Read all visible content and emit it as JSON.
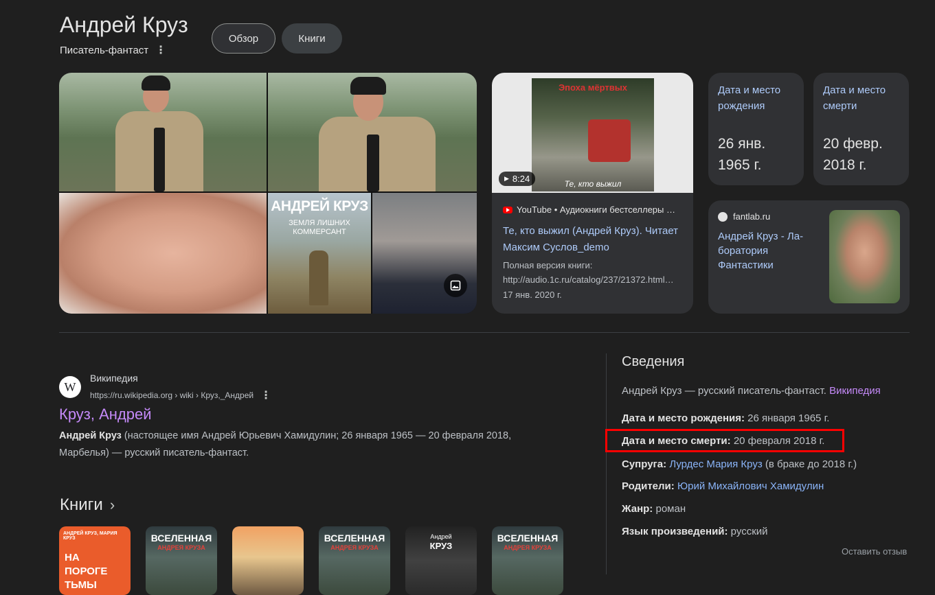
{
  "header": {
    "title": "Андрей Круз",
    "subtitle": "Писатель-фантаст",
    "tabs": [
      {
        "label": "Обзор",
        "selected": true
      },
      {
        "label": "Книги",
        "selected": false
      }
    ]
  },
  "images": {
    "tiles": [
      {
        "icon": "person-photo"
      },
      {
        "icon": "person-photo"
      },
      {
        "icon": "face-photo"
      },
      {
        "caption": "АНДРЕЙ КРУЗ",
        "subcaption": "ЗЕМЛЯ ЛИШНИХ",
        "subcaption2": "КОММЕРСАНТ"
      },
      {
        "icon": "face-photo"
      }
    ],
    "gallery_icon": "image-icon"
  },
  "video": {
    "duration": "8:24",
    "thumb_title": "Эпоха мёртвых",
    "thumb_caption": "Те, кто выжил",
    "source": "YouTube • Аудиокниги бестселлеры …",
    "title": "Те, кто выжил (Андрей Круз). Читает Максим Суслов_demo",
    "desc_line1": "Полная версия книги:",
    "desc_line2": "http://audio.1c.ru/catalog/237/21372.html…",
    "date": "17 янв. 2020 г."
  },
  "facts": [
    {
      "label": "Дата и место рождения",
      "value": "26 янв. 1965 г."
    },
    {
      "label": "Дата и место смерти",
      "value": "20 февр. 2018 г."
    }
  ],
  "fantlab": {
    "source": "fantlab.ru",
    "title": "Андрей Круз - Ла-боратория Фантастики"
  },
  "wiki": {
    "site": "Википедия",
    "url": "https://ru.wikipedia.org › wiki › Круз,_Андрей",
    "title": "Круз, Андрей",
    "snippet_bold": "Андрей Круз",
    "snippet": " (настоящее имя Андрей Юрьевич Хамидулин; 26 января 1965 — 20 февраля 2018, Марбелья) — русский писатель-фантаст."
  },
  "books": {
    "heading": "Книги",
    "items": [
      {
        "top": "АНДРЕЙ КРУЗ, МАРИЯ КРУЗ",
        "title": "НА ПОРОГЕ ТЬМЫ"
      },
      {
        "title": "ВСЕЛЕННАЯ",
        "sub": "АНДРЕЯ КРУЗА"
      },
      {
        "title": ""
      },
      {
        "title": "ВСЕЛЕННАЯ",
        "sub": "АНДРЕЯ КРУЗА"
      },
      {
        "top": "Андрей",
        "title": "КРУЗ"
      },
      {
        "title": "ВСЕЛЕННАЯ",
        "sub": "АНДРЕЯ КРУЗА"
      }
    ]
  },
  "info": {
    "heading": "Сведения",
    "description": "Андрей Круз — русский писатель-фантаст. ",
    "description_link": "Википедия",
    "rows": [
      {
        "label": "Дата и место рождения:",
        "value": " 26 января 1965 г."
      },
      {
        "label": "Дата и место смерти:",
        "value": " 20 февраля 2018 г."
      },
      {
        "label": "Супруга:",
        "link": "Лурдес Мария Круз",
        "value": " (в браке до 2018 г.)"
      },
      {
        "label": "Родители:",
        "link": "Юрий Михайлович Хамидулин"
      },
      {
        "label": "Жанр:",
        "value": " роман"
      },
      {
        "label": "Язык произведений:",
        "value": " русский"
      }
    ],
    "highlight_color": "#ff0000",
    "feedback": "Оставить отзыв"
  }
}
